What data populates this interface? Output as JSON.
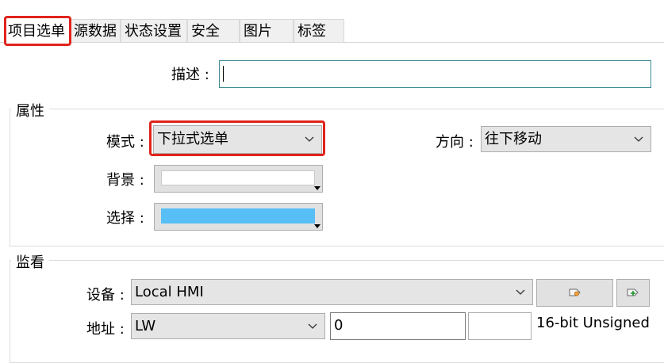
{
  "tabs": [
    {
      "label": "项目选单",
      "active": true
    },
    {
      "label": "源数据",
      "active": false
    },
    {
      "label": "状态设置",
      "active": false
    },
    {
      "label": "安全",
      "active": false
    },
    {
      "label": "图片",
      "active": false
    },
    {
      "label": "标签",
      "active": false
    }
  ],
  "description": {
    "label": "描述 :",
    "value": ""
  },
  "properties": {
    "title": "属性",
    "mode_label": "模式 :",
    "mode_value": "下拉式选单",
    "direction_label": "方向 :",
    "direction_value": "往下移动",
    "background_label": "背景 :",
    "background_color": "#ffffff",
    "selection_label": "选择 :",
    "selection_color": "#57bff5"
  },
  "monitor": {
    "title": "监看",
    "device_label": "设备 :",
    "device_value": "Local HMI",
    "address_label": "地址 :",
    "address_type": "LW",
    "address_value": "0",
    "address_extra": "",
    "data_format": "16-bit Unsigned"
  },
  "colors": {
    "highlight": "#e0241c",
    "input_border": "#3c8b92",
    "combo_bg": "#e5e5e5"
  },
  "icons": {
    "device_settings": "tag-settings-icon",
    "device_add": "tag-add-icon"
  }
}
